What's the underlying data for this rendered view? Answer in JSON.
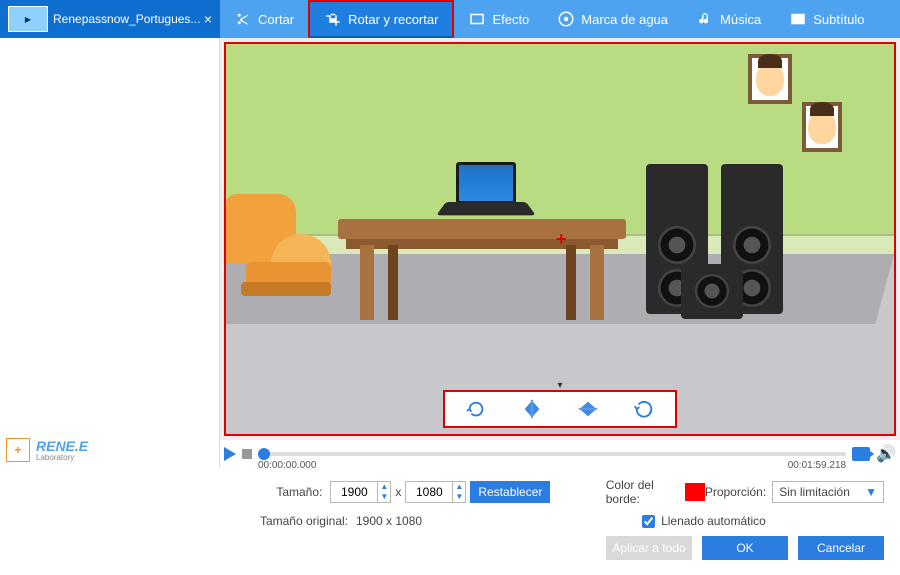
{
  "tab": {
    "label": "Renepassnow_Portugues..."
  },
  "toolbar": {
    "cut": "Cortar",
    "rotate": "Rotar y recortar",
    "effect": "Efecto",
    "watermark": "Marca de agua",
    "music": "Música",
    "subtitle": "Subtítulo"
  },
  "transport": {
    "current": "00:00:00.000",
    "total": "00:01:59.218"
  },
  "size": {
    "label": "Tamaño:",
    "w": "1900",
    "x": "x",
    "h": "1080",
    "reset": "Restablecer"
  },
  "orig": {
    "label": "Tamaño original:",
    "value": "1900 x 1080"
  },
  "border": {
    "label": "Color del borde:",
    "color": "#ff0000"
  },
  "ratio": {
    "label": "Proporción:",
    "value": "Sin limitación"
  },
  "autofill": {
    "label": "Llenado automático"
  },
  "footer": {
    "applyall": "Aplicar a todo",
    "ok": "OK",
    "cancel": "Cancelar"
  },
  "brand": {
    "name": "RENE.E",
    "sub": "Laboratory"
  }
}
